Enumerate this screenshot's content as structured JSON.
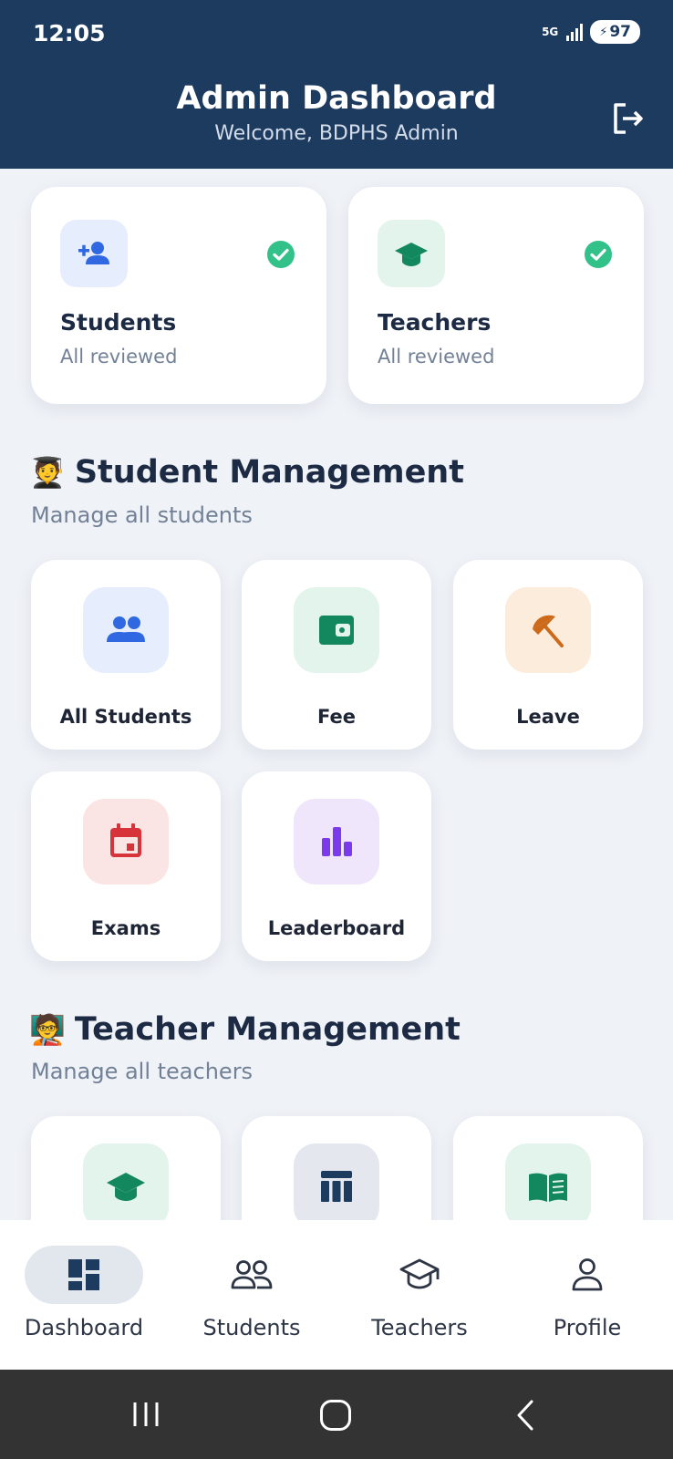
{
  "status_bar": {
    "time": "12:05",
    "network": "5G",
    "battery": "97"
  },
  "header": {
    "title": "Admin Dashboard",
    "subtitle": "Welcome, BDPHS Admin"
  },
  "summary": [
    {
      "title": "Students",
      "status": "All reviewed",
      "icon": "person-add-icon",
      "bg": "#e6edfd",
      "color": "#2f68e0"
    },
    {
      "title": "Teachers",
      "status": "All reviewed",
      "icon": "graduation-cap-icon",
      "bg": "#e3f4ec",
      "color": "#13875e"
    }
  ],
  "student_section": {
    "emoji": "🧑‍🎓",
    "title": "Student Management",
    "subtitle": "Manage all students",
    "tiles": [
      {
        "label": "All Students",
        "icon": "group-icon",
        "bg": "#e6edfd",
        "color": "#2f68e0"
      },
      {
        "label": "Fee",
        "icon": "wallet-icon",
        "bg": "#e3f4ec",
        "color": "#13875e"
      },
      {
        "label": "Leave",
        "icon": "beach-umbrella-icon",
        "bg": "#fcecdc",
        "color": "#cc6a1a"
      },
      {
        "label": "Exams",
        "icon": "calendar-icon",
        "bg": "#fbe4e4",
        "color": "#d6343a"
      },
      {
        "label": "Leaderboard",
        "icon": "bar-chart-icon",
        "bg": "#efe6fb",
        "color": "#7c3aed"
      }
    ]
  },
  "teacher_section": {
    "emoji": "🧑‍🏫",
    "title": "Teacher Management",
    "subtitle": "Manage all teachers",
    "tiles": [
      {
        "icon": "graduation-cap-icon",
        "bg": "#e3f4ec",
        "color": "#13875e"
      },
      {
        "icon": "timetable-icon",
        "bg": "#e4e8ee",
        "color": "#1d3a5f"
      },
      {
        "icon": "book-icon",
        "bg": "#e3f4ec",
        "color": "#13875e"
      }
    ]
  },
  "bottom_nav": [
    {
      "label": "Dashboard",
      "icon": "dashboard-icon",
      "active": true
    },
    {
      "label": "Students",
      "icon": "people-icon",
      "active": false
    },
    {
      "label": "Teachers",
      "icon": "graduation-cap-icon",
      "active": false
    },
    {
      "label": "Profile",
      "icon": "person-icon",
      "active": false
    }
  ],
  "colors": {
    "primary": "#1d3a5f",
    "background": "#eff2f7",
    "check": "#33c18a",
    "active_nav_bg": "#e2e6ed"
  }
}
